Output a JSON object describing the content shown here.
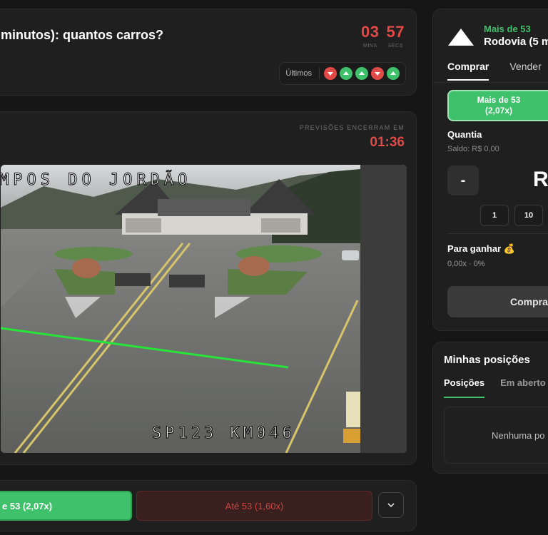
{
  "question": {
    "title": "minutos): quantos carros?",
    "timer": {
      "mins": "03",
      "secs": "57",
      "mins_label": "MINS",
      "secs_label": "SECS"
    },
    "ultimos": {
      "label": "Últimos",
      "results": [
        "down",
        "up",
        "up",
        "down",
        "up"
      ]
    }
  },
  "stream": {
    "previsoes_label": "PREVISÕES ENCERRAM EM",
    "previsoes_timer": "01:36",
    "overlay_top": "MPOS DO JORDÃO",
    "overlay_bottom": "SP123 KM046"
  },
  "bet": {
    "left_label": "e 53  (2,07x)",
    "right_label": "Até 53  (1,60x)"
  },
  "trade": {
    "market_tag": "Mais de 53",
    "market_title": "Rodovia (5 m",
    "tabs": [
      "Comprar",
      "Vender"
    ],
    "selected_option": "Mais de 53",
    "selected_odds": "(2,07x)",
    "quantia_label": "Quantia",
    "saldo": "Saldo: R$ 0,00",
    "minus": "-",
    "amount": "R",
    "chips": [
      "1",
      "10"
    ],
    "ganhar_label": "Para ganhar 💰",
    "ganhar_value": "0,00x · 0%",
    "buy_label": "Compra"
  },
  "positions": {
    "title": "Minhas posições",
    "tabs": [
      "Posições",
      "Em aberto"
    ],
    "empty": "Nenhuma po"
  },
  "colors": {
    "green": "#3fc06a",
    "red": "#e24a47",
    "panel": "#1f1f1f"
  }
}
